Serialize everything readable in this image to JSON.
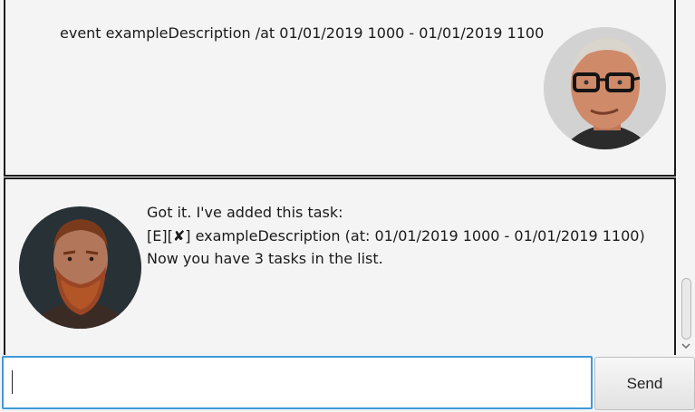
{
  "conversation": {
    "user_message": {
      "text": "event exampleDescription /at 01/01/2019 1000 - 01/01/2019 1100",
      "avatar": "user-avatar-man-with-glasses"
    },
    "bot_message": {
      "lines": [
        "Got it. I've added this task:",
        "[E][✘] exampleDescription (at: 01/01/2019 1000 - 01/01/2019 1100)",
        "Now you have 3 tasks in the list."
      ],
      "avatar": "bot-avatar-bearded-man"
    }
  },
  "input": {
    "value": "",
    "placeholder": ""
  },
  "send_button": {
    "label": "Send"
  },
  "scrollbar": {
    "down_arrow_icon": "chevron-down-icon"
  },
  "colors": {
    "background": "#f4f4f4",
    "border": "#1c1c1c",
    "input_focus": "#3e9ad9"
  }
}
